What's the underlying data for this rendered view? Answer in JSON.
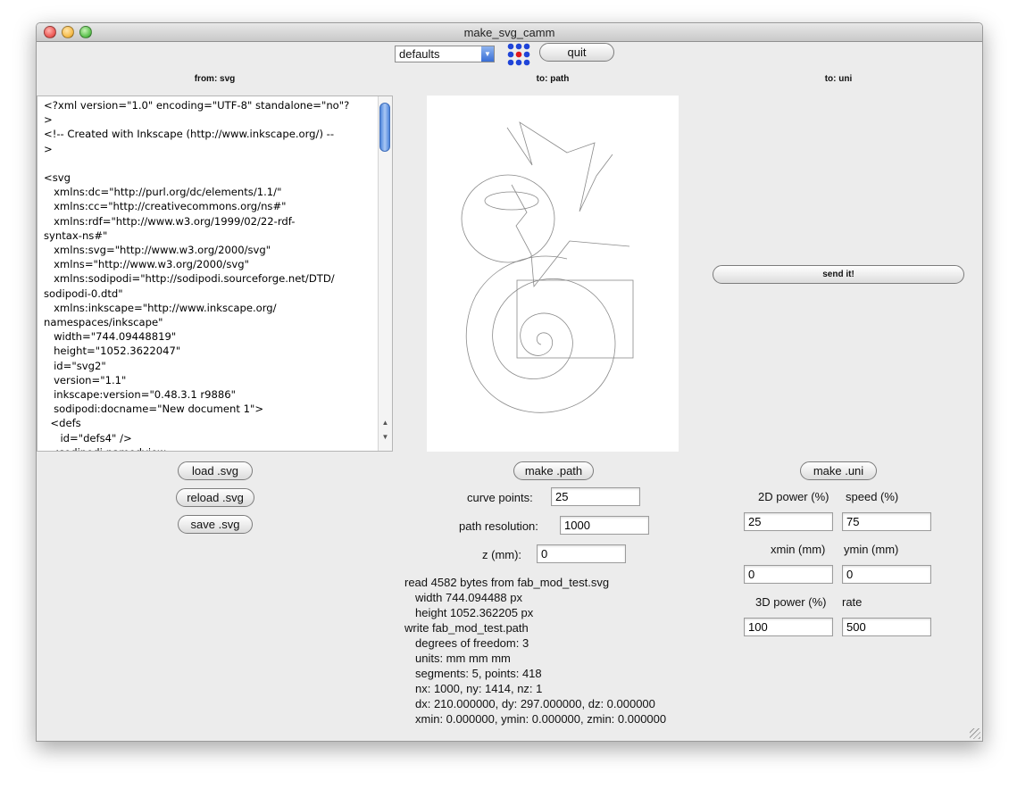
{
  "window": {
    "title": "make_svg_camm"
  },
  "toolbar": {
    "mode_select": "defaults",
    "quit_label": "quit",
    "logo_icon": "fab-dot-grid-icon"
  },
  "columns": {
    "from": "from: svg",
    "to_path": "to: path",
    "to_uni": "to: uni"
  },
  "source": {
    "lines": [
      "<?xml version=\"1.0\" encoding=\"UTF-8\" standalone=\"no\"?",
      ">",
      "<!-- Created with Inkscape (http://www.inkscape.org/) --",
      ">",
      "",
      "<svg",
      "   xmlns:dc=\"http://purl.org/dc/elements/1.1/\"",
      "   xmlns:cc=\"http://creativecommons.org/ns#\"",
      "   xmlns:rdf=\"http://www.w3.org/1999/02/22-rdf-",
      "syntax-ns#\"",
      "   xmlns:svg=\"http://www.w3.org/2000/svg\"",
      "   xmlns=\"http://www.w3.org/2000/svg\"",
      "   xmlns:sodipodi=\"http://sodipodi.sourceforge.net/DTD/",
      "sodipodi-0.dtd\"",
      "   xmlns:inkscape=\"http://www.inkscape.org/",
      "namespaces/inkscape\"",
      "   width=\"744.09448819\"",
      "   height=\"1052.3622047\"",
      "   id=\"svg2\"",
      "   version=\"1.1\"",
      "   inkscape:version=\"0.48.3.1 r9886\"",
      "   sodipodi:docname=\"New document 1\">",
      "  <defs",
      "     id=\"defs4\" />",
      "  <sodipodi:namedview"
    ]
  },
  "svg_buttons": {
    "load": "load .svg",
    "reload": "reload .svg",
    "save": "save .svg"
  },
  "path": {
    "make_label": "make .path",
    "curve_points_label": "curve points:",
    "curve_points_value": "25",
    "resolution_label": "path resolution:",
    "resolution_value": "1000",
    "z_label": "z (mm):",
    "z_value": "0"
  },
  "log": {
    "lines": [
      "read 4582 bytes from fab_mod_test.svg",
      "width 744.094488 px",
      "height 1052.362205 px",
      "write fab_mod_test.path",
      "degrees of freedom: 3",
      "units: mm mm mm",
      "segments: 5, points: 418",
      "nx: 1000, ny: 1414, nz: 1",
      "dx: 210.000000, dy: 297.000000, dz: 0.000000",
      "xmin: 0.000000, ymin: 0.000000, zmin: 0.000000"
    ]
  },
  "uni": {
    "send_label": "send it!",
    "make_label": "make .uni",
    "power_2d_label": "2D power (%)",
    "power_2d_value": "25",
    "speed_label": "speed (%)",
    "speed_value": "75",
    "xmin_label": "xmin (mm)",
    "xmin_value": "0",
    "ymin_label": "ymin (mm)",
    "ymin_value": "0",
    "power_3d_label": "3D power (%)",
    "power_3d_value": "100",
    "rate_label": "rate",
    "rate_value": "500"
  },
  "colors": {
    "window_bg": "#ececec",
    "accent_blue": "#3a6fd6",
    "logo_red": "#e0171e",
    "logo_blue": "#1f44d8",
    "close": "#ee5f5b",
    "minimize": "#f6be4f",
    "zoom": "#62c554"
  }
}
